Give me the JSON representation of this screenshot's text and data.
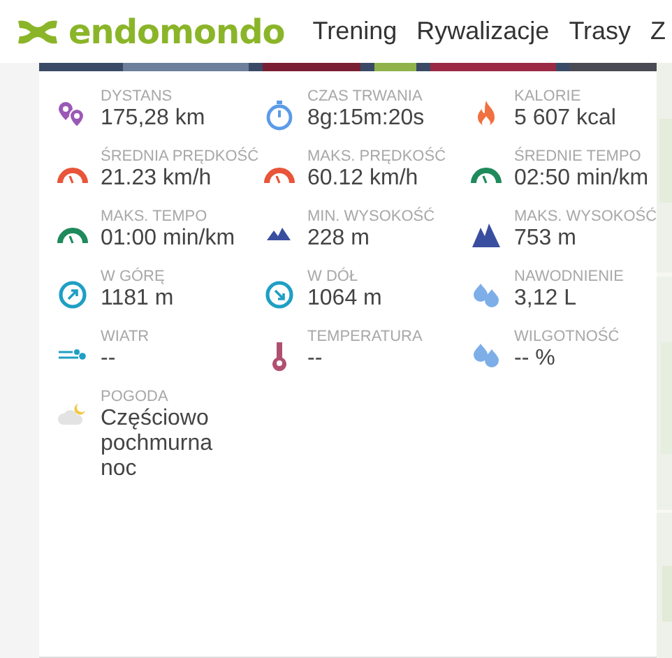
{
  "header": {
    "logo": "endomondo",
    "nav": [
      {
        "label": "Trening"
      },
      {
        "label": "Rywalizacje"
      },
      {
        "label": "Trasy"
      },
      {
        "label": "Z"
      }
    ]
  },
  "stats": [
    {
      "kind": "pins",
      "label": "DYSTANS",
      "value": "175,28 km"
    },
    {
      "kind": "stopwatch",
      "label": "CZAS TRWANIA",
      "value": "8g:15m:20s"
    },
    {
      "kind": "flame",
      "label": "KALORIE",
      "value": "5 607 kcal"
    },
    {
      "kind": "speed-gauge",
      "label": "ŚREDNIA PRĘDKOŚĆ",
      "value": "21.23 km/h"
    },
    {
      "kind": "speed-gauge",
      "label": "MAKS. PRĘDKOŚĆ",
      "value": "60.12 km/h"
    },
    {
      "kind": "pace-gauge",
      "label": "ŚREDNIE TEMPO",
      "value": "02:50 min/km"
    },
    {
      "kind": "pace-gauge",
      "label": "MAKS. TEMPO",
      "value": "01:00 min/km"
    },
    {
      "kind": "small-mountains",
      "label": "MIN. WYSOKOŚĆ",
      "value": "228 m"
    },
    {
      "kind": "big-mountains",
      "label": "MAKS. WYSOKOŚĆ",
      "value": "753 m"
    },
    {
      "kind": "ascent",
      "label": "W GÓRĘ",
      "value": "1181 m"
    },
    {
      "kind": "descent",
      "label": "W DÓŁ",
      "value": "1064 m"
    },
    {
      "kind": "drops",
      "label": "NAWODNIENIE",
      "value": "3,12 L"
    },
    {
      "kind": "wind",
      "label": "WIATR",
      "value": "--"
    },
    {
      "kind": "thermometer",
      "label": "TEMPERATURA",
      "value": "--"
    },
    {
      "kind": "drops",
      "label": "WILGOTNOŚĆ",
      "value": "-- %"
    },
    {
      "kind": "cloud-moon",
      "label": "POGODA",
      "value": "Częściowo pochmurna noc"
    }
  ]
}
